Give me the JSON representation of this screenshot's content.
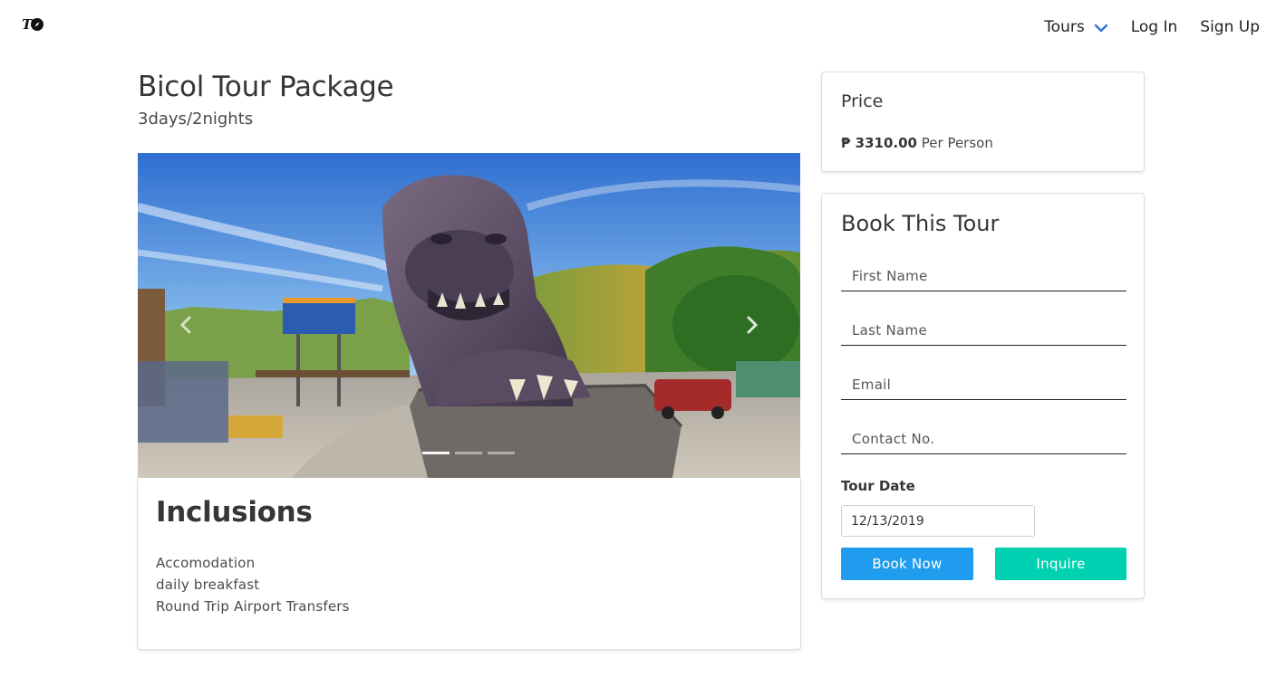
{
  "navbar": {
    "logo_text": "T",
    "tours_label": "Tours",
    "login_label": "Log In",
    "signup_label": "Sign Up",
    "chevron_color": "#3273dc"
  },
  "tour": {
    "title": "Bicol Tour Package",
    "duration": "3days/2nights"
  },
  "carousel": {
    "slide_count": 3,
    "active_index": 0,
    "image_icon": "lion-head-monument-photo",
    "prev_icon": "chevron-left-icon",
    "next_icon": "chevron-right-icon"
  },
  "inclusions": {
    "title": "Inclusions",
    "items": [
      "Accomodation",
      "daily breakfast",
      "Round Trip Airport Transfers"
    ]
  },
  "price": {
    "title": "Price",
    "amount": "₱ 3310.00",
    "unit": "Per Person"
  },
  "booking": {
    "title": "Book This Tour",
    "first_name_placeholder": "First Name",
    "last_name_placeholder": "Last Name",
    "email_placeholder": "Email",
    "contact_placeholder": "Contact No.",
    "date_label": "Tour Date",
    "date_value": "12/13/2019",
    "book_button": "Book Now",
    "inquire_button": "Inquire"
  },
  "colors": {
    "book_button": "#209cee",
    "inquire_button": "#00d1b2",
    "text": "#363636"
  }
}
